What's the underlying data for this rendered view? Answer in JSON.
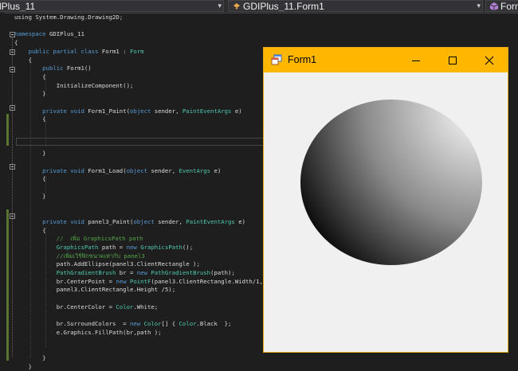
{
  "nav": {
    "scope": "lPlus_11",
    "type_name": "GDIPlus_11.Form1",
    "member": "Form"
  },
  "code_lines": [
    [
      "using System.Drawing.Drawing2D;"
    ],
    [
      ""
    ],
    [
      "namespace",
      " GDIPlus_11"
    ],
    [
      "{"
    ],
    [
      "    ",
      "public partial class",
      " Form1 : ",
      "Form"
    ],
    [
      "    {"
    ],
    [
      "        ",
      "public",
      " Form1()"
    ],
    [
      "        {"
    ],
    [
      "            InitializeComponent();"
    ],
    [
      "        }"
    ],
    [
      ""
    ],
    [
      "        ",
      "private void",
      " Form1_Paint(",
      "object",
      " sender, ",
      "PaintEventArgs",
      " e)"
    ],
    [
      "        {"
    ],
    [
      ""
    ],
    [
      ""
    ],
    [
      ""
    ],
    [
      "        }"
    ],
    [
      ""
    ],
    [
      "        ",
      "private void",
      " Form1_Load(",
      "object",
      " sender, ",
      "EventArgs",
      " e)"
    ],
    [
      "        {"
    ],
    [
      ""
    ],
    [
      "        }"
    ],
    [
      ""
    ],
    [
      ""
    ],
    [
      "        ",
      "private void",
      " panel3_Paint(",
      "object",
      " sender, ",
      "PaintEventArgs",
      " e)"
    ],
    [
      "        {"
    ],
    [
      "            ",
      "//  เพิ่ม GraphicsPath path"
    ],
    [
      "            ",
      "GraphicsPath",
      " path = ",
      "new",
      " ",
      "GraphicsPath",
      "();"
    ],
    [
      "            ",
      "//เพิ่มเวิร์ฟิกขนาดเท่ากับ panel3"
    ],
    [
      "            path.AddEllipse(panel3.ClientRectangle );"
    ],
    [
      "            ",
      "PathGradientBrush",
      " br = ",
      "new",
      " ",
      "PathGradientBrush",
      "(path);"
    ],
    [
      "            br.CenterPoint = ",
      "new",
      " ",
      "PointF",
      "(panel3.ClientRectangle.Width/1,"
    ],
    [
      "            panel3.ClientRectangle.Height /5);"
    ],
    [
      ""
    ],
    [
      "            br.CenterColor = ",
      "Color",
      ".White;"
    ],
    [
      ""
    ],
    [
      "            br.SurroundColors  = ",
      "new",
      " ",
      "Color",
      "[] { ",
      "Color",
      ".Black  };"
    ],
    [
      "            e.Graphics.FillPath(br,path );"
    ],
    [
      ""
    ],
    [
      ""
    ],
    [
      "        }"
    ],
    [
      "    }"
    ]
  ],
  "code_kinds": [
    [
      "t"
    ],
    [
      "t"
    ],
    [
      "k",
      "t"
    ],
    [
      "t"
    ],
    [
      "t",
      "k",
      "t",
      "y"
    ],
    [
      "t"
    ],
    [
      "t",
      "k",
      "t"
    ],
    [
      "t"
    ],
    [
      "t"
    ],
    [
      "t"
    ],
    [
      "t"
    ],
    [
      "t",
      "k",
      "t",
      "k",
      "t",
      "y",
      "t"
    ],
    [
      "t"
    ],
    [
      "t"
    ],
    [
      "t"
    ],
    [
      "t"
    ],
    [
      "t"
    ],
    [
      "t"
    ],
    [
      "t",
      "k",
      "t",
      "k",
      "t",
      "y",
      "t"
    ],
    [
      "t"
    ],
    [
      "t"
    ],
    [
      "t"
    ],
    [
      "t"
    ],
    [
      "t"
    ],
    [
      "t",
      "k",
      "t",
      "k",
      "t",
      "y",
      "t"
    ],
    [
      "t"
    ],
    [
      "t",
      "c"
    ],
    [
      "t",
      "y",
      "t",
      "k",
      "t",
      "y",
      "t"
    ],
    [
      "t",
      "c"
    ],
    [
      "t"
    ],
    [
      "t",
      "y",
      "t",
      "k",
      "t",
      "y",
      "t"
    ],
    [
      "t",
      "k",
      "t",
      "y",
      "t"
    ],
    [
      "t"
    ],
    [
      "t"
    ],
    [
      "t",
      "y",
      "t"
    ],
    [
      "t"
    ],
    [
      "t",
      "k",
      "t",
      "y",
      "t",
      "y",
      "t"
    ],
    [
      "t"
    ],
    [
      "t"
    ],
    [
      "t"
    ],
    [
      "t"
    ],
    [
      "t"
    ]
  ],
  "form": {
    "title": "Form1"
  },
  "colors": {
    "title_bar": "#ffb600",
    "center_color": "#ffffff",
    "surround_color": "#000000"
  }
}
